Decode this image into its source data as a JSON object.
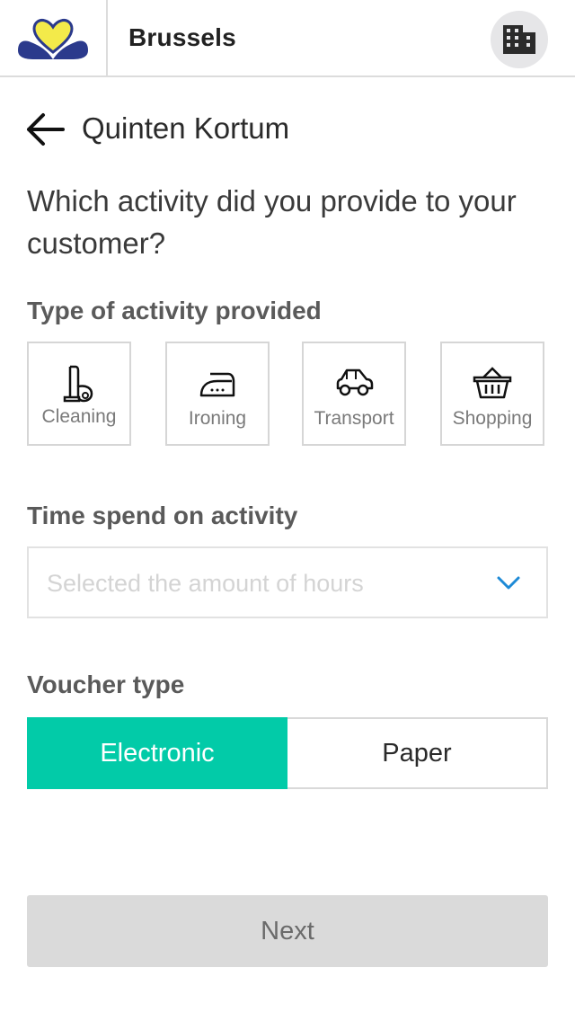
{
  "header": {
    "city": "Brussels",
    "logo_icon": "brussels-heart-logo",
    "building_icon": "building-icon"
  },
  "customer": {
    "name": "Quinten Kortum",
    "back_icon": "arrow-left-icon"
  },
  "question": "Which activity did you provide to your customer?",
  "activity_section": {
    "label": "Type of activity provided",
    "items": [
      {
        "label": "Cleaning",
        "icon": "vacuum-icon"
      },
      {
        "label": "Ironing",
        "icon": "iron-icon"
      },
      {
        "label": "Transport",
        "icon": "car-icon"
      },
      {
        "label": "Shopping",
        "icon": "basket-icon"
      }
    ]
  },
  "time_section": {
    "label": "Time spend on activity",
    "placeholder": "Selected the amount of hours",
    "chevron_icon": "chevron-down-icon"
  },
  "voucher_section": {
    "label": "Voucher type",
    "options": [
      "Electronic",
      "Paper"
    ],
    "selected": "Electronic"
  },
  "next_button": "Next",
  "colors": {
    "accent": "#02cba8",
    "logo_navy": "#2b3a8c",
    "logo_yellow": "#f3ea4a",
    "chevron_blue": "#1e8ad6"
  }
}
